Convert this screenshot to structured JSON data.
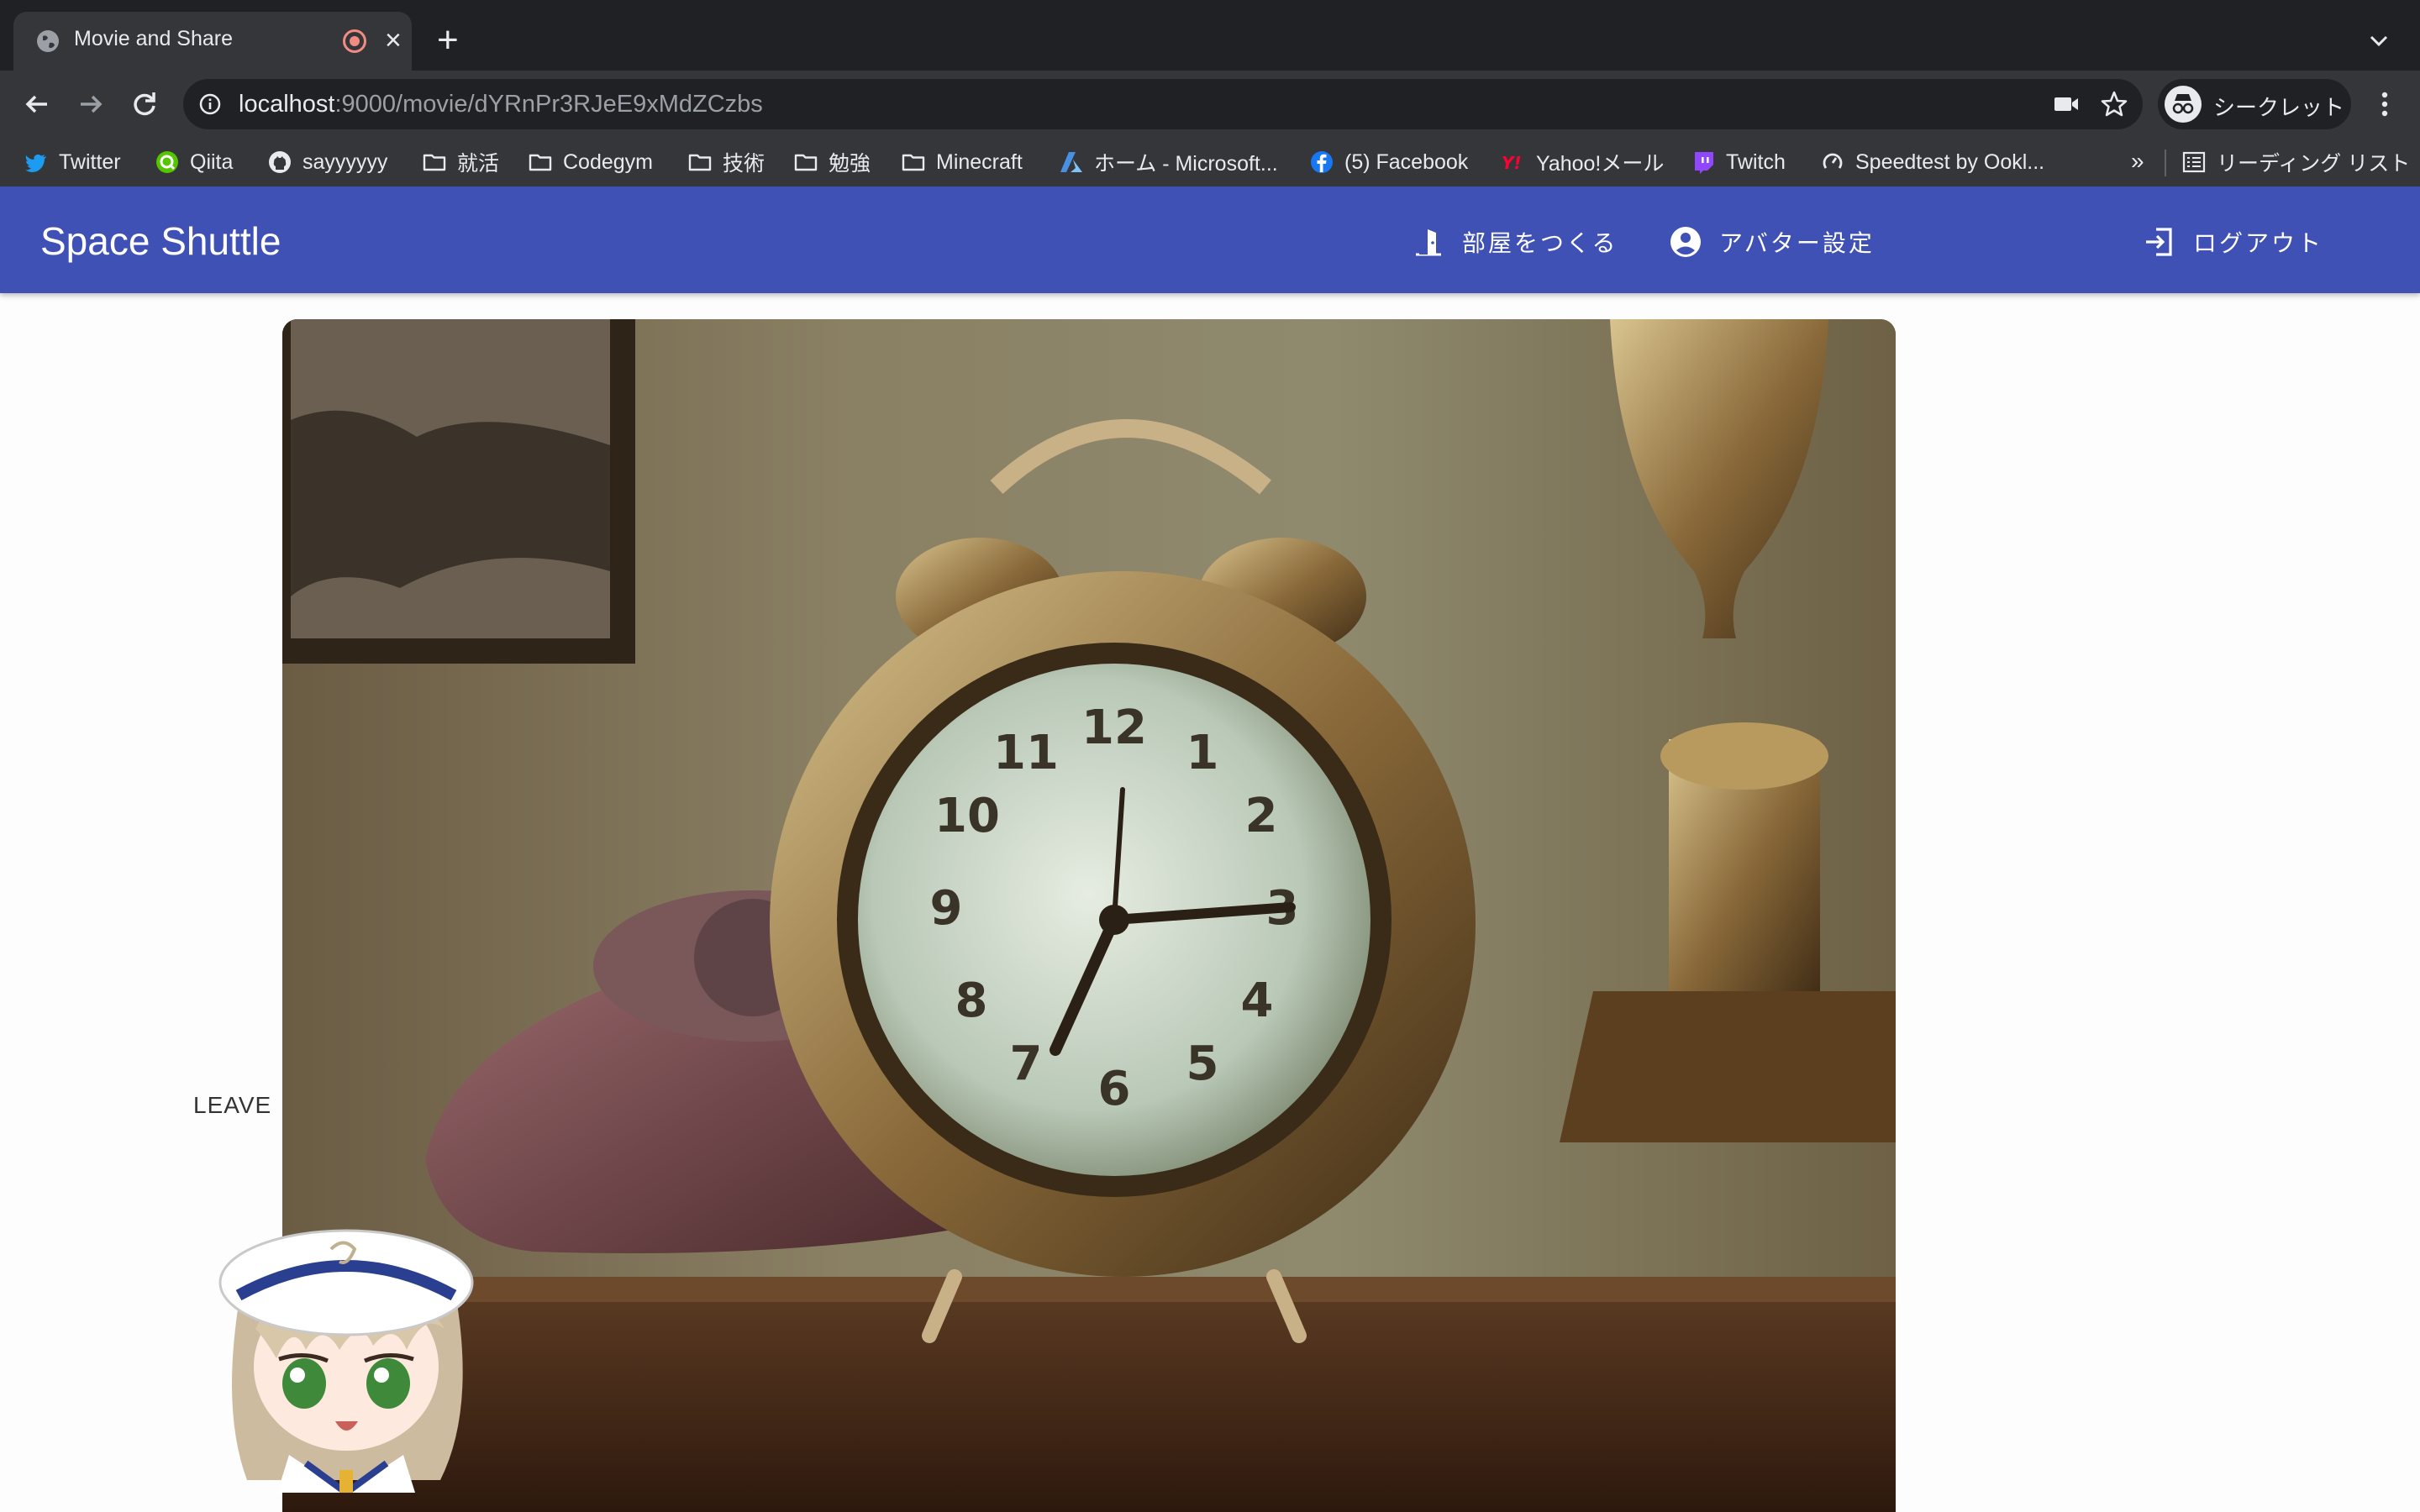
{
  "browser": {
    "tab_title": "Movie and Share",
    "url_host": "localhost",
    "url_path": ":9000/movie/dYRnPr3RJeE9xMdZCzbs",
    "profile_label": "シークレット",
    "icons": [
      "globe-icon",
      "recording-icon",
      "close-icon",
      "new-tab-icon",
      "tab-search-icon",
      "back-icon",
      "forward-icon",
      "reload-icon",
      "info-icon",
      "camera-icon",
      "star-icon",
      "incognito-icon",
      "menu-icon"
    ],
    "bookmarks": [
      {
        "label": "Twitter",
        "icon": "twitter-icon"
      },
      {
        "label": "Qiita",
        "icon": "qiita-icon"
      },
      {
        "label": "sayyyyyy",
        "icon": "github-icon"
      },
      {
        "label": "就活",
        "icon": "folder-icon"
      },
      {
        "label": "Codegym",
        "icon": "folder-icon"
      },
      {
        "label": "技術",
        "icon": "folder-icon"
      },
      {
        "label": "勉強",
        "icon": "folder-icon"
      },
      {
        "label": "Minecraft",
        "icon": "folder-icon"
      },
      {
        "label": "ホーム - Microsoft...",
        "icon": "azure-icon"
      },
      {
        "label": "(5) Facebook",
        "icon": "facebook-icon"
      },
      {
        "label": "Yahoo!メール",
        "icon": "yahoo-icon"
      },
      {
        "label": "Twitch",
        "icon": "twitch-icon"
      },
      {
        "label": "Speedtest by Ookl...",
        "icon": "speedtest-icon"
      }
    ],
    "bookmarks_overflow": "»",
    "reading_list": "リーディング リスト"
  },
  "app": {
    "brand": "Space Shuttle",
    "create_room": "部屋をつくる",
    "avatar_settings": "アバター設定",
    "logout": "ログアウト",
    "leave": "LEAVE",
    "accent_color": "#3f51b5"
  }
}
